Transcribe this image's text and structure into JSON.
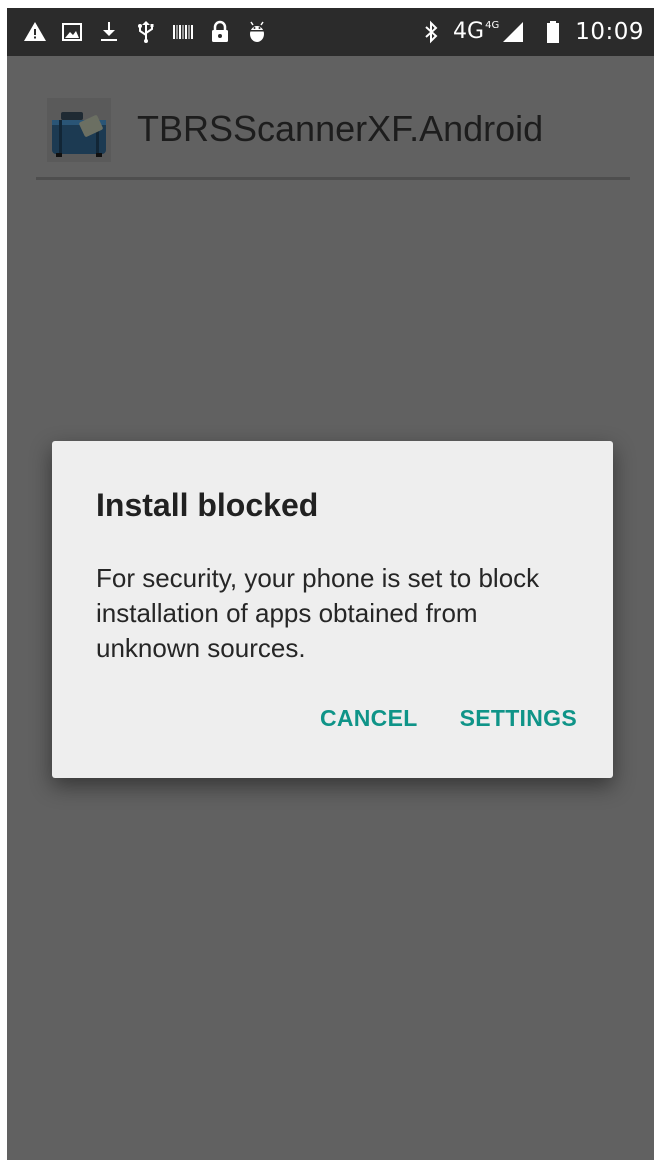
{
  "status_bar": {
    "left_icons": [
      "warning-icon",
      "image-icon",
      "download-icon",
      "usb-icon",
      "barcode-icon",
      "lock-icon",
      "android-debug-icon"
    ],
    "right_icons": [
      "bluetooth-icon",
      "signal-icon",
      "battery-icon"
    ],
    "network_label": "4G",
    "network_sup": "4G",
    "time": "10:09"
  },
  "app": {
    "title": "TBRSScannerXF.Android",
    "icon": "suitcase-app-icon"
  },
  "dialog": {
    "title": "Install blocked",
    "message": "For security, your phone is set to block installation of apps obtained from unknown sources.",
    "cancel_label": "CANCEL",
    "settings_label": "SETTINGS"
  },
  "colors": {
    "status_bar": "#2b2b2b",
    "background_dim": "#616161",
    "dialog": "#eeeeee",
    "accent": "#0f9488"
  }
}
